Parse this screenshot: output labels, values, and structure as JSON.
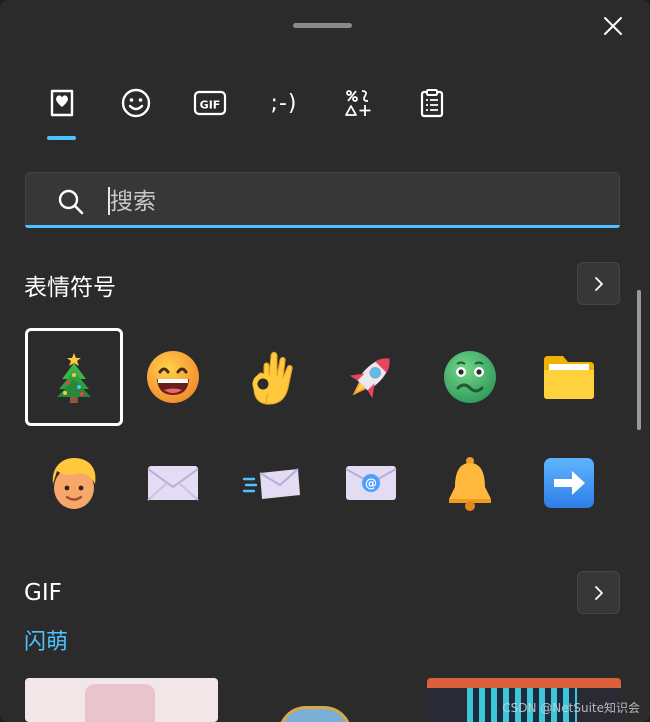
{
  "search": {
    "placeholder": "搜索"
  },
  "emoji_section": {
    "title": "表情符号"
  },
  "gif_section": {
    "title": "GIF",
    "subcategory": "闪萌"
  },
  "tabs": [
    {
      "name": "favorites"
    },
    {
      "name": "emoji"
    },
    {
      "name": "gif",
      "label": "GIF"
    },
    {
      "name": "kaomoji",
      "label": ";-)"
    },
    {
      "name": "symbols"
    },
    {
      "name": "clipboard"
    }
  ],
  "emoji_grid": [
    {
      "name": "christmas-tree-emoji",
      "char": "🎄",
      "selected": true
    },
    {
      "name": "grinning-face-emoji",
      "char": "😄"
    },
    {
      "name": "ok-hand-emoji",
      "char": "👌"
    },
    {
      "name": "rocket-emoji",
      "char": "🚀"
    },
    {
      "name": "nauseated-face-emoji",
      "char": "🤢"
    },
    {
      "name": "folder-emoji",
      "char": "📁"
    },
    {
      "name": "person-blond-emoji",
      "char": "👱"
    },
    {
      "name": "envelope-emoji",
      "char": "✉️"
    },
    {
      "name": "incoming-envelope-emoji",
      "char": "📨"
    },
    {
      "name": "email-emoji",
      "char": "📧"
    },
    {
      "name": "bell-emoji",
      "char": "🔔"
    },
    {
      "name": "right-arrow-emoji",
      "char": "➡️"
    }
  ],
  "watermark": "CSDN @NetSuite知识会",
  "colors": {
    "accent": "#4cc2ff",
    "panel": "#2b2b2b",
    "field": "#373737"
  }
}
